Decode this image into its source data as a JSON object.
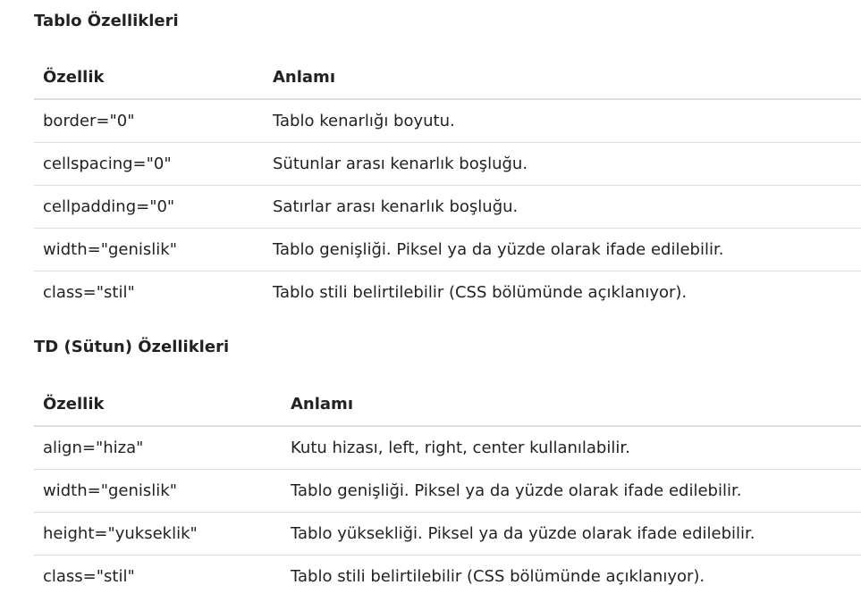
{
  "sections": [
    {
      "title": "Tablo Özellikleri",
      "headers": {
        "property": "Özellik",
        "meaning": "Anlamı"
      },
      "rows": [
        {
          "property": "border=\"0\"",
          "meaning": "Tablo kenarlığı boyutu."
        },
        {
          "property": "cellspacing=\"0\"",
          "meaning": "Sütunlar arası kenarlık boşluğu."
        },
        {
          "property": "cellpadding=\"0\"",
          "meaning": "Satırlar arası kenarlık boşluğu."
        },
        {
          "property": "width=\"genislik\"",
          "meaning": "Tablo genişliği. Piksel ya da yüzde olarak ifade edilebilir."
        },
        {
          "property": "class=\"stil\"",
          "meaning": "Tablo stili belirtilebilir (CSS bölümünde açıklanıyor)."
        }
      ]
    },
    {
      "title": "TD (Sütun) Özellikleri",
      "headers": {
        "property": "Özellik",
        "meaning": "Anlamı"
      },
      "rows": [
        {
          "property": "align=\"hiza\"",
          "meaning": "Kutu hizası, left, right, center kullanılabilir."
        },
        {
          "property": "width=\"genislik\"",
          "meaning": "Tablo genişliği. Piksel ya da yüzde olarak ifade edilebilir."
        },
        {
          "property": "height=\"yukseklik\"",
          "meaning": "Tablo yüksekliği. Piksel ya da yüzde olarak ifade edilebilir."
        },
        {
          "property": "class=\"stil\"",
          "meaning": "Tablo stili belirtilebilir (CSS bölümünde açıklanıyor)."
        }
      ]
    }
  ]
}
